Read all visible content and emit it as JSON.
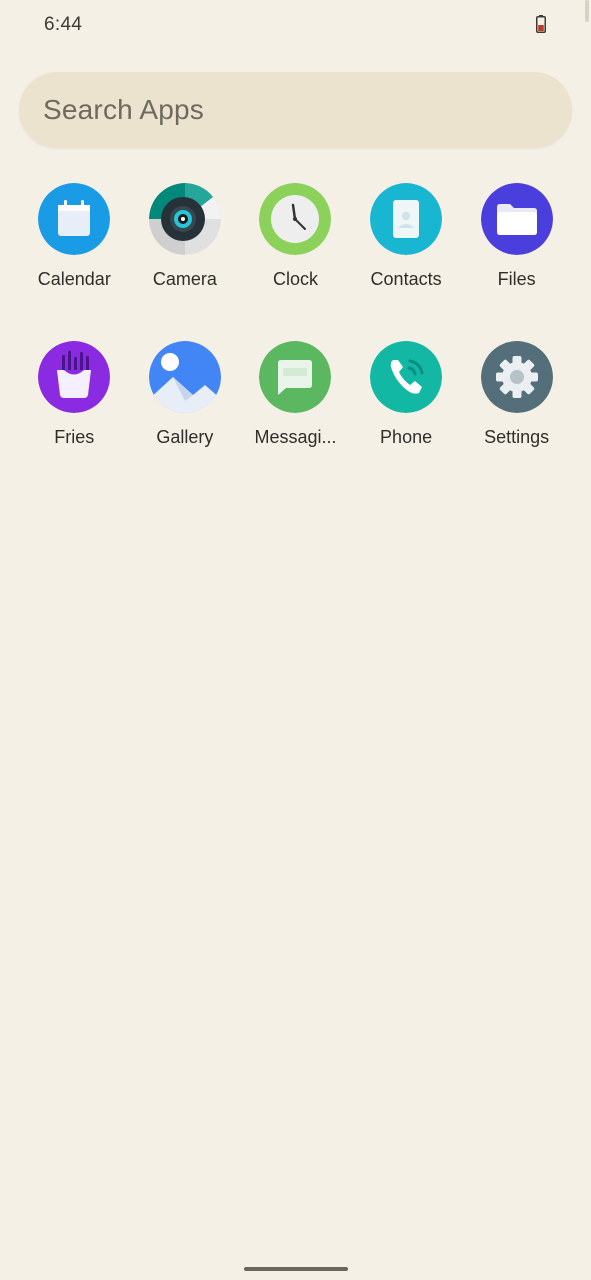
{
  "status_bar": {
    "time": "6:44",
    "battery_icon": "battery-low-icon",
    "battery_color": "#c0392b"
  },
  "search": {
    "placeholder": "Search Apps"
  },
  "apps": [
    {
      "label": "Calendar",
      "icon": "calendar-icon",
      "color": "#1a9be6"
    },
    {
      "label": "Camera",
      "icon": "camera-icon",
      "color": "#00897b"
    },
    {
      "label": "Clock",
      "icon": "clock-icon",
      "color": "#8bd15a"
    },
    {
      "label": "Contacts",
      "icon": "contacts-icon",
      "color": "#19b6d2"
    },
    {
      "label": "Files",
      "icon": "folder-icon",
      "color": "#4a3fdc"
    },
    {
      "label": "Fries",
      "icon": "fries-icon",
      "color": "#8a2be2"
    },
    {
      "label": "Gallery",
      "icon": "gallery-icon",
      "color": "#4285f4"
    },
    {
      "label": "Messagi...",
      "icon": "message-icon",
      "color": "#5cb860"
    },
    {
      "label": "Phone",
      "icon": "phone-icon",
      "color": "#13b8a4"
    },
    {
      "label": "Settings",
      "icon": "gear-icon",
      "color": "#546e7a"
    }
  ]
}
